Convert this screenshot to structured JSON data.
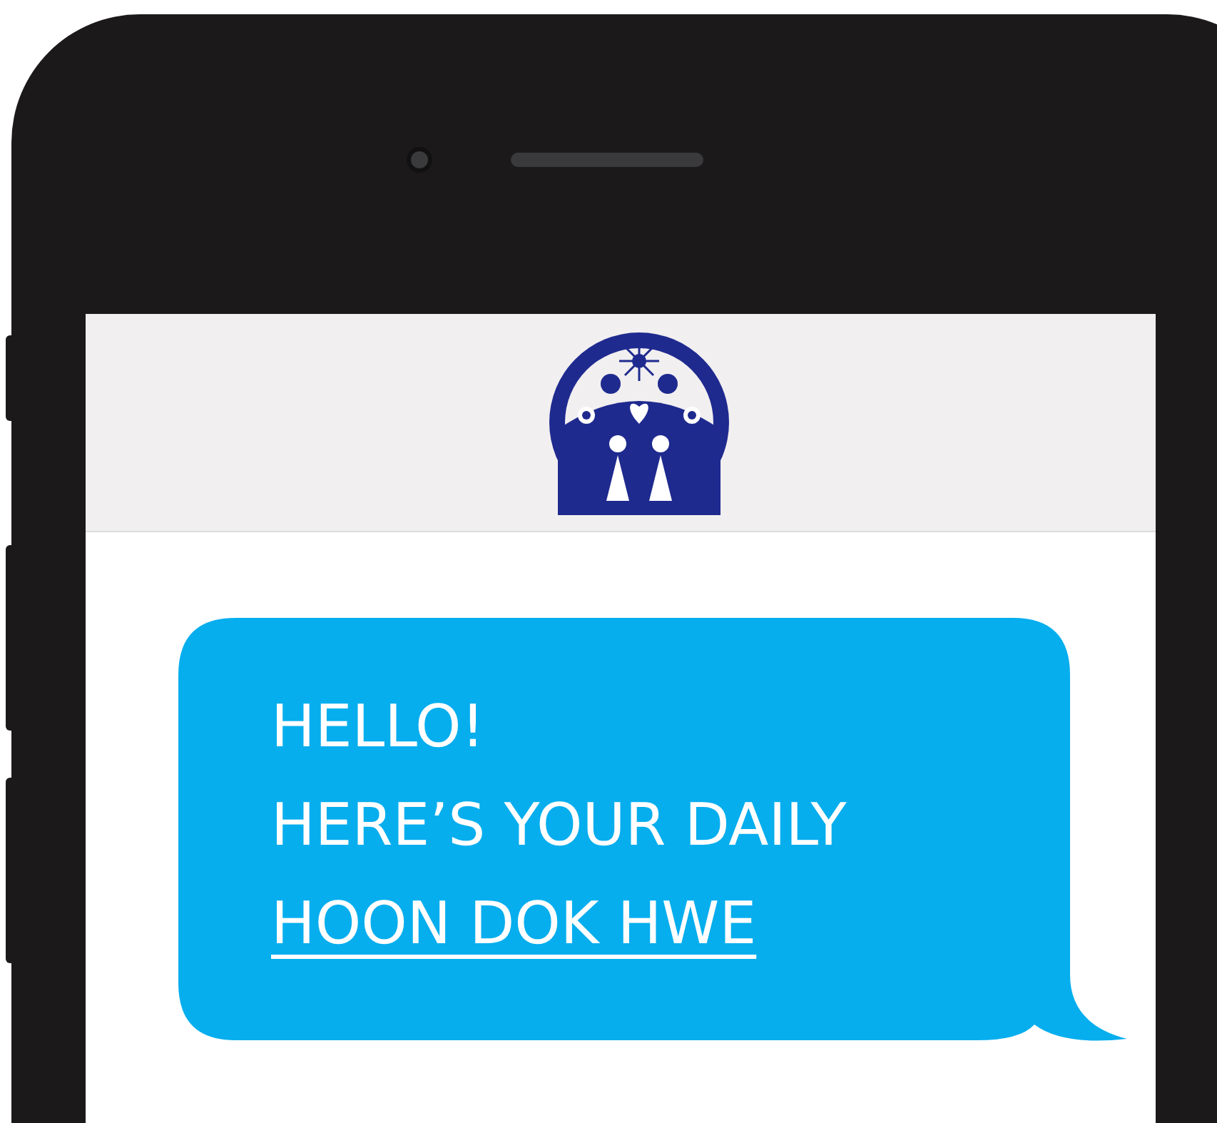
{
  "message": {
    "lines": [
      "HELLO!",
      "HERE’S YOUR DAILY"
    ],
    "link": "HOON DOK HWE"
  }
}
